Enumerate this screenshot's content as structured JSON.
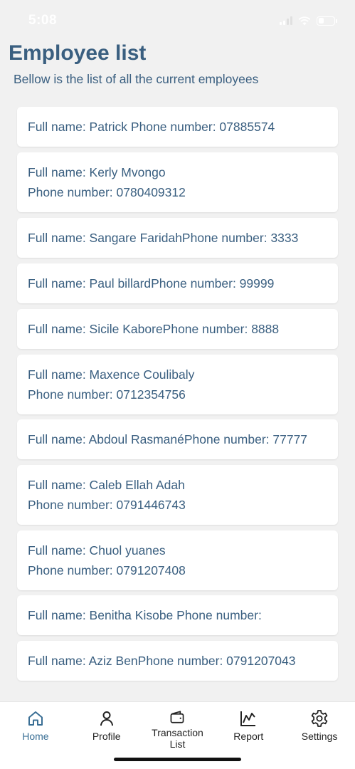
{
  "status_bar": {
    "time": "5:08"
  },
  "header": {
    "title": "Employee list",
    "subtitle": "Bellow is the list of all the current employees"
  },
  "employees": [
    {
      "line1": "Full name: Patrick Phone number: 07885574",
      "line2": ""
    },
    {
      "line1": "Full name: Kerly Mvongo",
      "line2": "Phone number: 0780409312"
    },
    {
      "line1": "Full name: Sangare FaridahPhone number: 3333",
      "line2": ""
    },
    {
      "line1": "Full name: Paul billardPhone number: 99999",
      "line2": ""
    },
    {
      "line1": "Full name: Sicile KaborePhone number: 8888",
      "line2": ""
    },
    {
      "line1": "Full name: Maxence Coulibaly",
      "line2": "Phone number: 0712354756"
    },
    {
      "line1": "Full name: Abdoul RasmanéPhone number: 77777",
      "line2": ""
    },
    {
      "line1": "Full name: Caleb Ellah Adah",
      "line2": "Phone number: 0791446743"
    },
    {
      "line1": "Full name: Chuol yuanes",
      "line2": "Phone number: 0791207408"
    },
    {
      "line1": "Full name: Benitha Kisobe Phone number:",
      "line2": ""
    },
    {
      "line1": "Full name: Aziz BenPhone number: 0791207043",
      "line2": ""
    }
  ],
  "bottom_nav": {
    "items": [
      {
        "label": "Home",
        "icon": "home-icon",
        "active": true
      },
      {
        "label": "Profile",
        "icon": "person-icon",
        "active": false
      },
      {
        "label": "Transaction List",
        "icon": "wallet-icon",
        "active": false
      },
      {
        "label": "Report",
        "icon": "chart-icon",
        "active": false
      },
      {
        "label": "Settings",
        "icon": "gear-icon",
        "active": false
      }
    ]
  },
  "colors": {
    "accent": "#3a5f80",
    "active_nav": "#3a6f95",
    "background": "#f1f1f1",
    "card": "#ffffff"
  }
}
